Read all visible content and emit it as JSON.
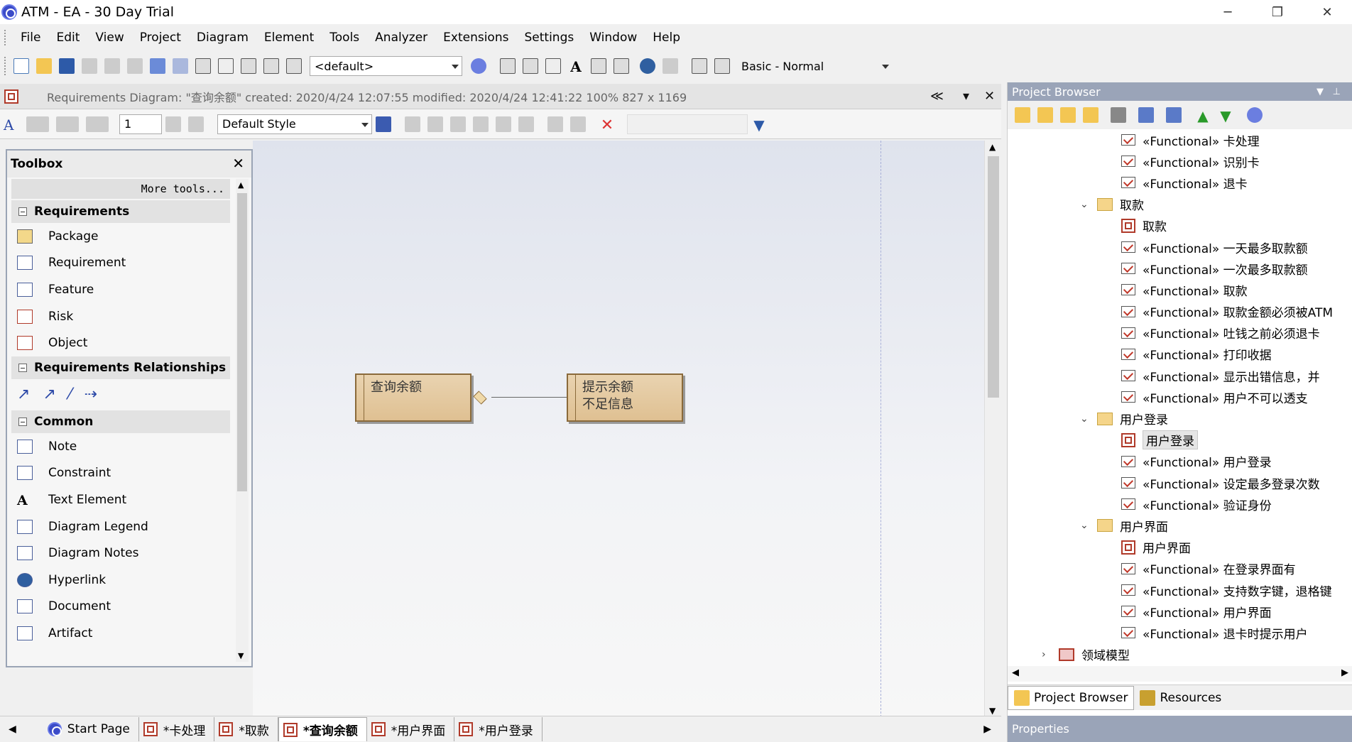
{
  "window": {
    "title": "ATM - EA - 30 Day Trial",
    "min": "─",
    "max": "❐",
    "close": "✕"
  },
  "menu": [
    "File",
    "Edit",
    "View",
    "Project",
    "Diagram",
    "Element",
    "Tools",
    "Analyzer",
    "Extensions",
    "Settings",
    "Window",
    "Help"
  ],
  "toolbar": {
    "combo_default": "<default>",
    "combo_workspace": "Basic - Normal"
  },
  "diagram_header": {
    "info": "Requirements Diagram: \"查询余额\"   created: 2020/4/24 12:07:55  modified: 2020/4/24 12:41:22   100%   827 x 1169",
    "collapse": "≪",
    "menu": "▾",
    "close": "✕"
  },
  "diagram_toolbar": {
    "line_width": "1",
    "style": "Default Style"
  },
  "toolbox": {
    "title": "Toolbox",
    "close": "✕",
    "more_tools": "More tools...",
    "sections": [
      {
        "name": "Requirements",
        "items": [
          "Package",
          "Requirement",
          "Feature",
          "Risk",
          "Object"
        ]
      },
      {
        "name": "Requirements Relationships",
        "items": []
      },
      {
        "name": "Common",
        "items": [
          "Note",
          "Constraint",
          "Text Element",
          "Diagram Legend",
          "Diagram Notes",
          "Hyperlink",
          "Document",
          "Artifact"
        ]
      }
    ]
  },
  "elements": {
    "e1": "查询余额",
    "e2_line1": "提示余额",
    "e2_line2": "不足信息"
  },
  "tabs": [
    "Start Page",
    "*卡处理",
    "*取款",
    "*查询余额",
    "*用户界面",
    "*用户登录"
  ],
  "project_browser": {
    "title": "Project Browser",
    "tabs": [
      "Project Browser",
      "Resources"
    ],
    "tree": [
      {
        "t": "req",
        "label": "«Functional» 卡处理"
      },
      {
        "t": "req",
        "label": "«Functional» 识别卡"
      },
      {
        "t": "req",
        "label": "«Functional» 退卡"
      },
      {
        "t": "folder",
        "label": "取款"
      },
      {
        "t": "diag",
        "label": "取款"
      },
      {
        "t": "req",
        "label": "«Functional» 一天最多取款额"
      },
      {
        "t": "req",
        "label": "«Functional» 一次最多取款额"
      },
      {
        "t": "req",
        "label": "«Functional» 取款"
      },
      {
        "t": "req",
        "label": "«Functional» 取款金额必须被ATM"
      },
      {
        "t": "req",
        "label": "«Functional» 吐钱之前必须退卡"
      },
      {
        "t": "req",
        "label": "«Functional» 打印收据"
      },
      {
        "t": "req",
        "label": "«Functional» 显示出错信息，并"
      },
      {
        "t": "req",
        "label": "«Functional» 用户不可以透支"
      },
      {
        "t": "folder",
        "label": "用户登录"
      },
      {
        "t": "diag",
        "label": "用户登录",
        "selected": true
      },
      {
        "t": "req",
        "label": "«Functional» 用户登录"
      },
      {
        "t": "req",
        "label": "«Functional» 设定最多登录次数"
      },
      {
        "t": "req",
        "label": "«Functional» 验证身份"
      },
      {
        "t": "folder",
        "label": "用户界面"
      },
      {
        "t": "diag",
        "label": "用户界面"
      },
      {
        "t": "req",
        "label": "«Functional» 在登录界面有"
      },
      {
        "t": "req",
        "label": "«Functional» 支持数字键，退格键"
      },
      {
        "t": "req",
        "label": "«Functional» 用户界面"
      },
      {
        "t": "req",
        "label": "«Functional» 退卡时提示用户"
      },
      {
        "t": "pkg",
        "label": "领域模型"
      }
    ]
  },
  "properties": {
    "title": "Properties"
  }
}
